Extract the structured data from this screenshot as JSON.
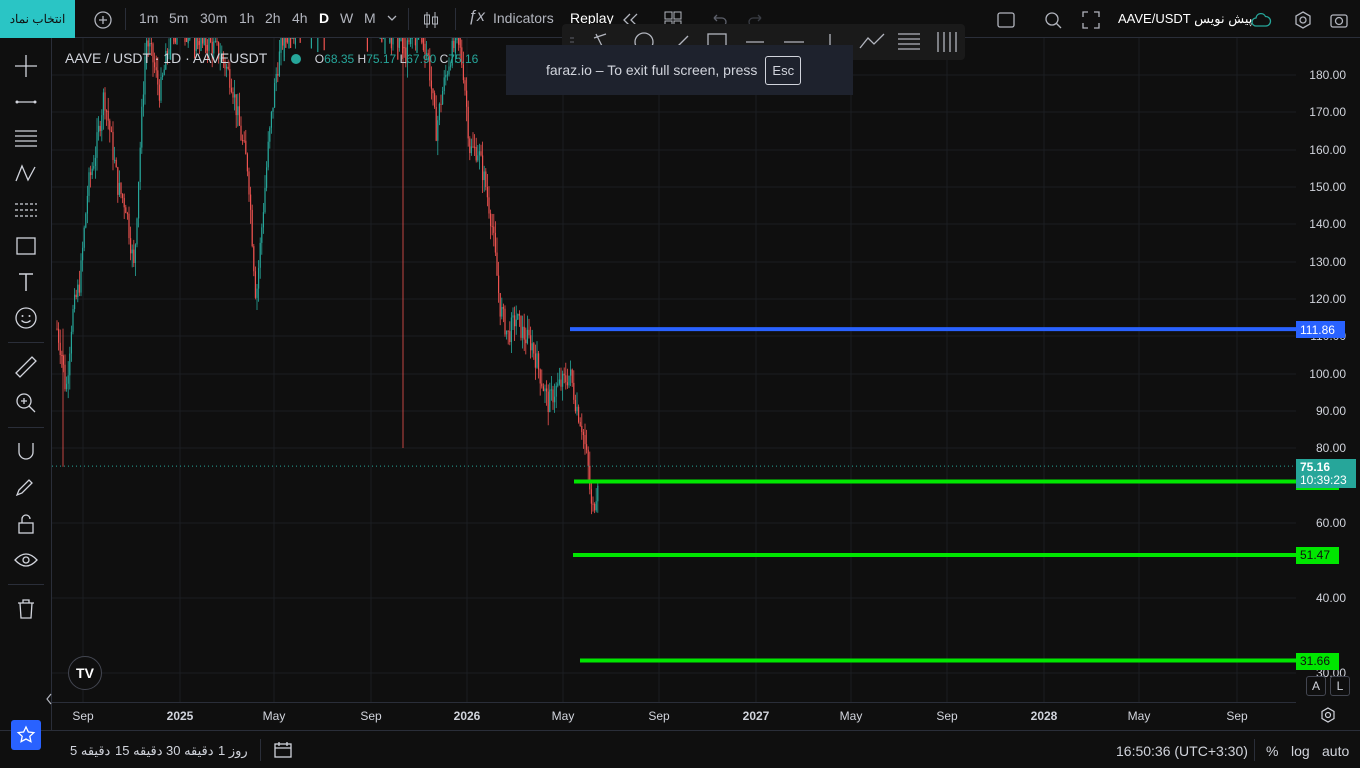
{
  "topbar": {
    "symbol_button": "انتخاب نماد",
    "intervals": [
      "1m",
      "5m",
      "30m",
      "1h",
      "2h",
      "4h",
      "D",
      "W",
      "M"
    ],
    "active_interval": "D",
    "indicators_label": "Indicators",
    "replay_label": "Replay",
    "symbol_title": "AAVE/USDT پیش نویس"
  },
  "legend": {
    "title": "AAVE / USDT · 1D · AAVEUSDT",
    "o_key": "O",
    "o_val": "68.35",
    "h_key": "H",
    "h_val": "75.17",
    "l_key": "L",
    "l_val": "67.90",
    "c_key": "C",
    "c_val": "75.16"
  },
  "fullscreen_toast": {
    "text": "faraz.io – To exit full screen, press",
    "key": "Esc"
  },
  "price_axis": {
    "labels": [
      "180.00",
      "170.00",
      "160.00",
      "150.00",
      "140.00",
      "130.00",
      "120.00",
      "110.00",
      "100.00",
      "90.00",
      "80.00",
      "60.00",
      "40.00",
      "30.00"
    ],
    "current_price": "75.16",
    "countdown": "10:39:23"
  },
  "horizontal_lines": [
    {
      "price": "111.86",
      "color": "#2962ff"
    },
    {
      "price": "71.08",
      "color": "#00e600"
    },
    {
      "price": "51.47",
      "color": "#00e600"
    },
    {
      "price": "31.66",
      "color": "#00e600"
    }
  ],
  "time_axis": {
    "labels": [
      {
        "text": "Sep",
        "strong": false
      },
      {
        "text": "2025",
        "strong": true
      },
      {
        "text": "May",
        "strong": false
      },
      {
        "text": "Sep",
        "strong": false
      },
      {
        "text": "2026",
        "strong": true
      },
      {
        "text": "May",
        "strong": false
      },
      {
        "text": "Sep",
        "strong": false
      },
      {
        "text": "2027",
        "strong": true
      },
      {
        "text": "May",
        "strong": false
      },
      {
        "text": "Sep",
        "strong": false
      },
      {
        "text": "2028",
        "strong": true
      },
      {
        "text": "May",
        "strong": false
      },
      {
        "text": "Sep",
        "strong": false
      }
    ]
  },
  "scale_buttons": {
    "a": "A",
    "l": "L"
  },
  "bottombar": {
    "ranges": [
      "5 دقیقه",
      "15 دقیقه",
      "30 دقیقه",
      "1 روز"
    ],
    "clock": "16:50:36 (UTC+3:30)",
    "percent": "%",
    "log": "log",
    "auto": "auto"
  },
  "colors": {
    "up": "#26a69a",
    "down": "#ef5350",
    "accent": "#2ac5c5"
  },
  "chart_data": {
    "type": "candlestick",
    "symbol": "AAVE/USDT",
    "interval": "1D",
    "last": {
      "open": 68.35,
      "high": 75.17,
      "low": 67.9,
      "close": 75.16
    },
    "ylim": [
      30,
      185
    ],
    "yticks": [
      30,
      40,
      60,
      80,
      90,
      100,
      110,
      120,
      130,
      140,
      150,
      160,
      170,
      180
    ],
    "horizontal_levels": [
      111.86,
      71.08,
      51.47,
      31.66
    ],
    "current_price": 75.16
  }
}
